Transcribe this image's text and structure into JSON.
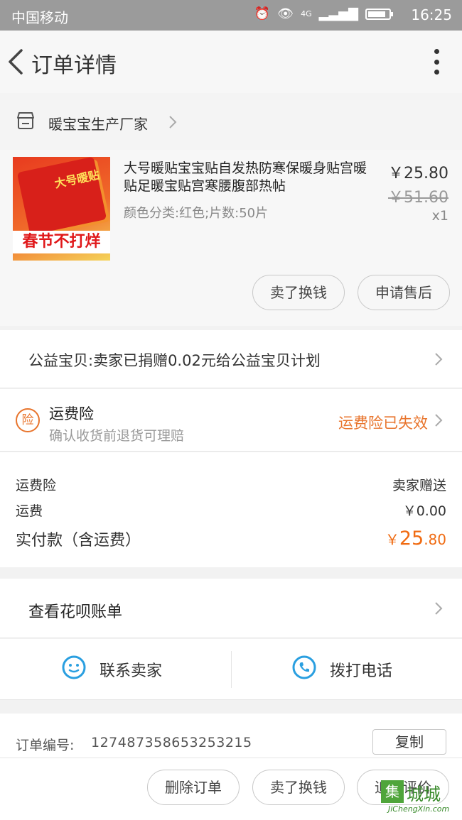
{
  "status_bar": {
    "carrier": "中国移动",
    "network": "4G",
    "time": "16:25"
  },
  "navbar": {
    "title": "订单详情"
  },
  "shop": {
    "name": "暖宝宝生产厂家"
  },
  "product": {
    "title": "大号暖贴宝宝贴自发热防寒保暖身贴宫暖贴足暖宝贴宫寒腰腹部热帖",
    "sku": "颜色分类:红色;片数:50片",
    "price": "￥25.80",
    "original_price": "￥51.60",
    "quantity": "x1",
    "thumbnail_banner": "春节不打烊",
    "actions": [
      "卖了换钱",
      "申请售后"
    ]
  },
  "charity": {
    "text": "公益宝贝:卖家已捐赠0.02元给公益宝贝计划"
  },
  "insurance": {
    "badge": "险",
    "title": "运费险",
    "subtitle": "确认收货前退货可理赔",
    "status": "运费险已失效"
  },
  "fees": {
    "insurance_label": "运费险",
    "insurance_value": "卖家赠送",
    "shipping_label": "运费",
    "shipping_value": "￥0.00",
    "total_label": "实付款（含运费）",
    "total_currency": "￥",
    "total_int": "25",
    "total_dec": ".80"
  },
  "bill": {
    "text": "查看花呗账单"
  },
  "contact": {
    "seller": "联系卖家",
    "phone": "拨打电话"
  },
  "order": {
    "label": "订单编号:",
    "number": "127487358653253215",
    "copy": "复制"
  },
  "bottom_actions": [
    "删除订单",
    "卖了换钱",
    "追加评价"
  ],
  "watermark": {
    "text": "城城",
    "url": "JiChengXin.com"
  },
  "colors": {
    "accent_orange": "#f06b12",
    "contact_blue": "#2a9fe0"
  }
}
